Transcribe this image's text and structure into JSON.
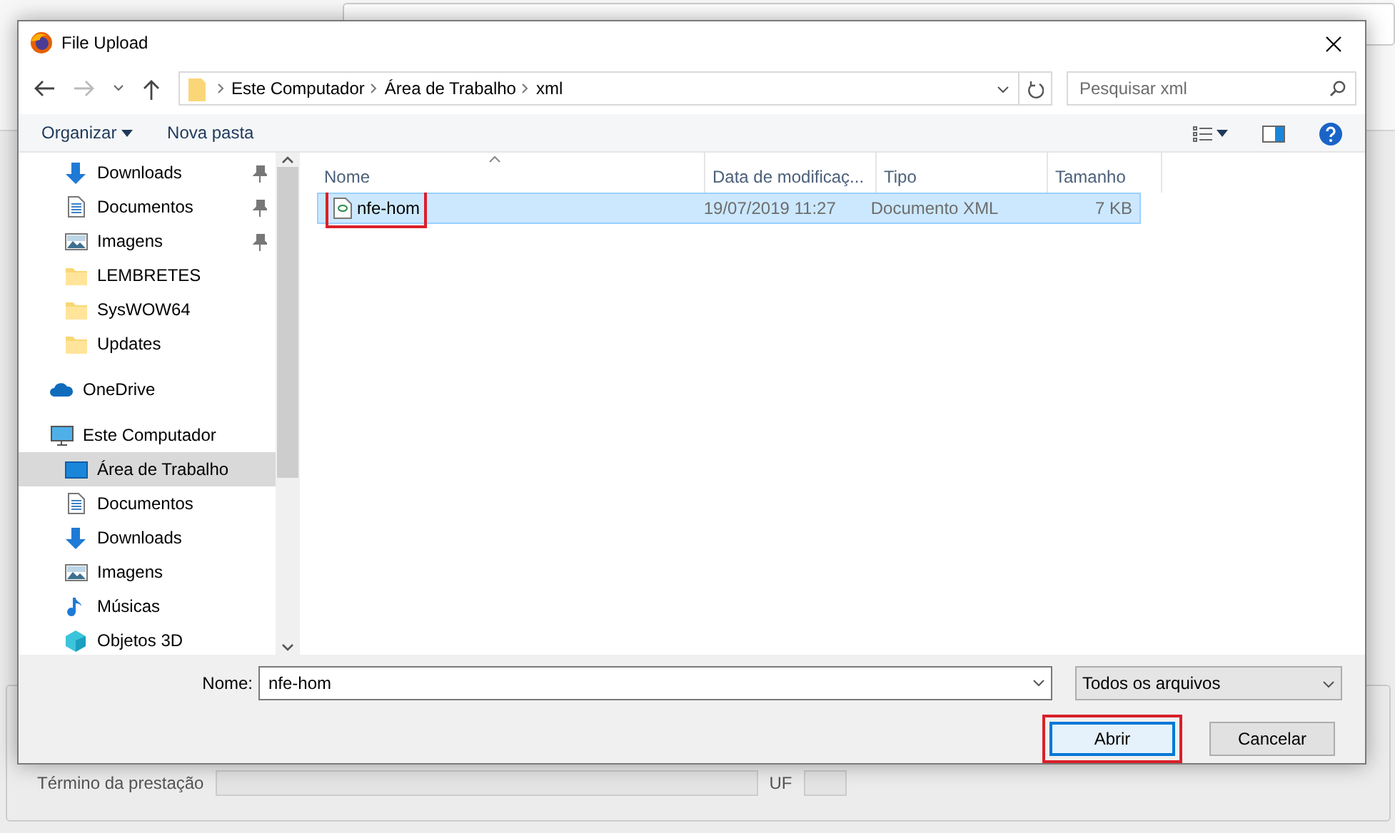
{
  "background": {
    "form_label": "Término da prestação",
    "uf_label": "UF"
  },
  "dialog": {
    "title": "File Upload",
    "breadcrumb": [
      "Este Computador",
      "Área de Trabalho",
      "xml"
    ],
    "search": {
      "placeholder": "Pesquisar xml"
    },
    "toolbar": [
      {
        "label": "Organizar",
        "dropdown": true
      },
      {
        "label": "Nova pasta",
        "dropdown": false
      }
    ],
    "nav": [
      {
        "label": "Downloads",
        "kind": "download",
        "pinned": true,
        "selected": false
      },
      {
        "label": "Documentos",
        "kind": "document",
        "pinned": true,
        "selected": false
      },
      {
        "label": "Imagens",
        "kind": "image",
        "pinned": true,
        "selected": false
      },
      {
        "label": "LEMBRETES",
        "kind": "folder",
        "pinned": false,
        "selected": false
      },
      {
        "label": "SysWOW64",
        "kind": "folder",
        "pinned": false,
        "selected": false
      },
      {
        "label": "Updates",
        "kind": "folder",
        "pinned": false,
        "selected": false
      },
      {
        "label": "OneDrive",
        "kind": "cloud",
        "pinned": false,
        "selected": false
      },
      {
        "label": "Este Computador",
        "kind": "computer",
        "pinned": false,
        "selected": false,
        "children": [
          {
            "label": "Área de Trabalho",
            "kind": "desktop",
            "pinned": false,
            "selected": true
          },
          {
            "label": "Documentos",
            "kind": "document",
            "pinned": false,
            "selected": false
          },
          {
            "label": "Downloads",
            "kind": "download",
            "pinned": false,
            "selected": false
          },
          {
            "label": "Imagens",
            "kind": "image",
            "pinned": false,
            "selected": false
          },
          {
            "label": "Músicas",
            "kind": "music",
            "pinned": false,
            "selected": false
          },
          {
            "label": "Objetos 3D",
            "kind": "cube",
            "pinned": false,
            "selected": false
          }
        ]
      }
    ],
    "columns": [
      "Nome",
      "Data de modificaç...",
      "Tipo",
      "Tamanho"
    ],
    "files": [
      {
        "name": "nfe-hom",
        "modified": "19/07/2019 11:27",
        "type": "Documento XML",
        "size": "7 KB",
        "selected": true,
        "annotated": true
      }
    ],
    "filename": {
      "label": "Nome:",
      "value": "nfe-hom"
    },
    "filter": "Todos os arquivos",
    "buttons": [
      {
        "label": "Abrir",
        "default": true,
        "annotated": true
      },
      {
        "label": "Cancelar",
        "default": false,
        "annotated": false
      }
    ]
  }
}
